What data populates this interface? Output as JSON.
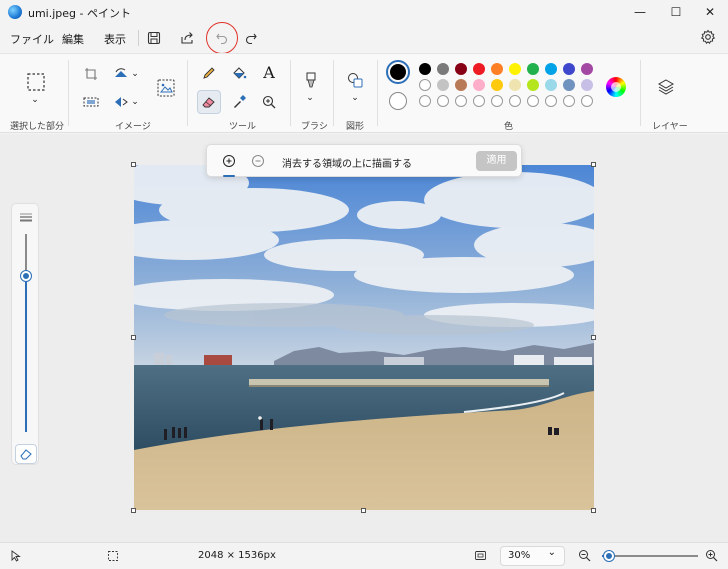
{
  "window": {
    "title": "umi.jpeg - ペイント",
    "minimize": "—",
    "maximize": "☐",
    "close": "✕"
  },
  "menu": {
    "file": "ファイル",
    "edit": "編集",
    "view": "表示"
  },
  "ribbon": {
    "groups": {
      "selection": "選択した部分",
      "image": "イメージ",
      "tools": "ツール",
      "brushes": "ブラシ",
      "shapes": "図形",
      "colors": "色",
      "layers": "レイヤー"
    },
    "text_tool_glyph": "A",
    "colors": {
      "primary": "#000000",
      "secondary": "#ffffff",
      "row1": [
        "#000000",
        "#7a7a7a",
        "#880015",
        "#ed1c24",
        "#ff7f27",
        "#fff200",
        "#22b14c",
        "#00a2e8",
        "#3f48cc",
        "#a349a4"
      ],
      "row2": [
        "#ffffff",
        "#c3c3c3",
        "#b97a57",
        "#ffaec9",
        "#ffc90e",
        "#efe4b0",
        "#b5e61d",
        "#99d9ea",
        "#7092be",
        "#c8bfe7"
      ]
    }
  },
  "erase_popup": {
    "instruction": "消去する領域の上に描画する",
    "apply": "適用"
  },
  "status": {
    "dimensions": "2048 × 1536px",
    "zoom": "30%"
  },
  "icons": {
    "app": "paint-app-icon",
    "save": "save-icon",
    "share": "share-icon",
    "undo": "undo-icon",
    "redo": "redo-icon",
    "settings": "gear-icon"
  }
}
